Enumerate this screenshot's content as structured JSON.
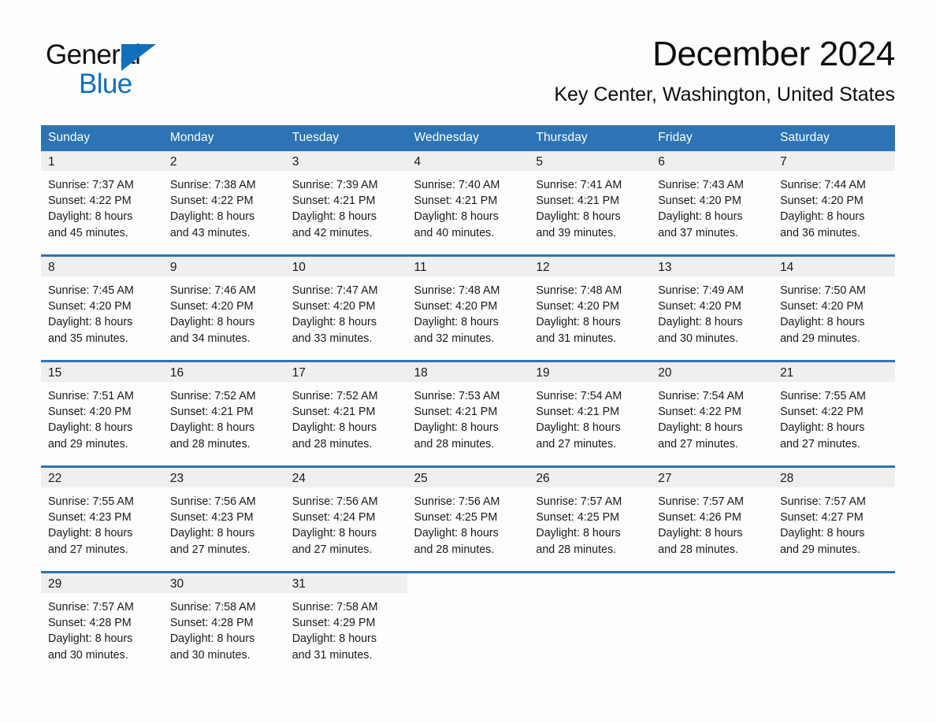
{
  "brand": {
    "line1": "General",
    "line2": "Blue",
    "mark": "triangle-logo",
    "accent_color": "#1270ba"
  },
  "header": {
    "month_title": "December 2024",
    "location": "Key Center, Washington, United States"
  },
  "theme": {
    "header_blue": "#2c74b3",
    "daybar_gray": "#efefef",
    "page_background": "#fdfdfd",
    "text_color": "#1a1a1a"
  },
  "calendar": {
    "weekday_headers": [
      "Sunday",
      "Monday",
      "Tuesday",
      "Wednesday",
      "Thursday",
      "Friday",
      "Saturday"
    ],
    "weeks": [
      [
        {
          "day": "1",
          "sunrise": "Sunrise: 7:37 AM",
          "sunset": "Sunset: 4:22 PM",
          "daylight_line1": "Daylight: 8 hours",
          "daylight_line2": "and 45 minutes."
        },
        {
          "day": "2",
          "sunrise": "Sunrise: 7:38 AM",
          "sunset": "Sunset: 4:22 PM",
          "daylight_line1": "Daylight: 8 hours",
          "daylight_line2": "and 43 minutes."
        },
        {
          "day": "3",
          "sunrise": "Sunrise: 7:39 AM",
          "sunset": "Sunset: 4:21 PM",
          "daylight_line1": "Daylight: 8 hours",
          "daylight_line2": "and 42 minutes."
        },
        {
          "day": "4",
          "sunrise": "Sunrise: 7:40 AM",
          "sunset": "Sunset: 4:21 PM",
          "daylight_line1": "Daylight: 8 hours",
          "daylight_line2": "and 40 minutes."
        },
        {
          "day": "5",
          "sunrise": "Sunrise: 7:41 AM",
          "sunset": "Sunset: 4:21 PM",
          "daylight_line1": "Daylight: 8 hours",
          "daylight_line2": "and 39 minutes."
        },
        {
          "day": "6",
          "sunrise": "Sunrise: 7:43 AM",
          "sunset": "Sunset: 4:20 PM",
          "daylight_line1": "Daylight: 8 hours",
          "daylight_line2": "and 37 minutes."
        },
        {
          "day": "7",
          "sunrise": "Sunrise: 7:44 AM",
          "sunset": "Sunset: 4:20 PM",
          "daylight_line1": "Daylight: 8 hours",
          "daylight_line2": "and 36 minutes."
        }
      ],
      [
        {
          "day": "8",
          "sunrise": "Sunrise: 7:45 AM",
          "sunset": "Sunset: 4:20 PM",
          "daylight_line1": "Daylight: 8 hours",
          "daylight_line2": "and 35 minutes."
        },
        {
          "day": "9",
          "sunrise": "Sunrise: 7:46 AM",
          "sunset": "Sunset: 4:20 PM",
          "daylight_line1": "Daylight: 8 hours",
          "daylight_line2": "and 34 minutes."
        },
        {
          "day": "10",
          "sunrise": "Sunrise: 7:47 AM",
          "sunset": "Sunset: 4:20 PM",
          "daylight_line1": "Daylight: 8 hours",
          "daylight_line2": "and 33 minutes."
        },
        {
          "day": "11",
          "sunrise": "Sunrise: 7:48 AM",
          "sunset": "Sunset: 4:20 PM",
          "daylight_line1": "Daylight: 8 hours",
          "daylight_line2": "and 32 minutes."
        },
        {
          "day": "12",
          "sunrise": "Sunrise: 7:48 AM",
          "sunset": "Sunset: 4:20 PM",
          "daylight_line1": "Daylight: 8 hours",
          "daylight_line2": "and 31 minutes."
        },
        {
          "day": "13",
          "sunrise": "Sunrise: 7:49 AM",
          "sunset": "Sunset: 4:20 PM",
          "daylight_line1": "Daylight: 8 hours",
          "daylight_line2": "and 30 minutes."
        },
        {
          "day": "14",
          "sunrise": "Sunrise: 7:50 AM",
          "sunset": "Sunset: 4:20 PM",
          "daylight_line1": "Daylight: 8 hours",
          "daylight_line2": "and 29 minutes."
        }
      ],
      [
        {
          "day": "15",
          "sunrise": "Sunrise: 7:51 AM",
          "sunset": "Sunset: 4:20 PM",
          "daylight_line1": "Daylight: 8 hours",
          "daylight_line2": "and 29 minutes."
        },
        {
          "day": "16",
          "sunrise": "Sunrise: 7:52 AM",
          "sunset": "Sunset: 4:21 PM",
          "daylight_line1": "Daylight: 8 hours",
          "daylight_line2": "and 28 minutes."
        },
        {
          "day": "17",
          "sunrise": "Sunrise: 7:52 AM",
          "sunset": "Sunset: 4:21 PM",
          "daylight_line1": "Daylight: 8 hours",
          "daylight_line2": "and 28 minutes."
        },
        {
          "day": "18",
          "sunrise": "Sunrise: 7:53 AM",
          "sunset": "Sunset: 4:21 PM",
          "daylight_line1": "Daylight: 8 hours",
          "daylight_line2": "and 28 minutes."
        },
        {
          "day": "19",
          "sunrise": "Sunrise: 7:54 AM",
          "sunset": "Sunset: 4:21 PM",
          "daylight_line1": "Daylight: 8 hours",
          "daylight_line2": "and 27 minutes."
        },
        {
          "day": "20",
          "sunrise": "Sunrise: 7:54 AM",
          "sunset": "Sunset: 4:22 PM",
          "daylight_line1": "Daylight: 8 hours",
          "daylight_line2": "and 27 minutes."
        },
        {
          "day": "21",
          "sunrise": "Sunrise: 7:55 AM",
          "sunset": "Sunset: 4:22 PM",
          "daylight_line1": "Daylight: 8 hours",
          "daylight_line2": "and 27 minutes."
        }
      ],
      [
        {
          "day": "22",
          "sunrise": "Sunrise: 7:55 AM",
          "sunset": "Sunset: 4:23 PM",
          "daylight_line1": "Daylight: 8 hours",
          "daylight_line2": "and 27 minutes."
        },
        {
          "day": "23",
          "sunrise": "Sunrise: 7:56 AM",
          "sunset": "Sunset: 4:23 PM",
          "daylight_line1": "Daylight: 8 hours",
          "daylight_line2": "and 27 minutes."
        },
        {
          "day": "24",
          "sunrise": "Sunrise: 7:56 AM",
          "sunset": "Sunset: 4:24 PM",
          "daylight_line1": "Daylight: 8 hours",
          "daylight_line2": "and 27 minutes."
        },
        {
          "day": "25",
          "sunrise": "Sunrise: 7:56 AM",
          "sunset": "Sunset: 4:25 PM",
          "daylight_line1": "Daylight: 8 hours",
          "daylight_line2": "and 28 minutes."
        },
        {
          "day": "26",
          "sunrise": "Sunrise: 7:57 AM",
          "sunset": "Sunset: 4:25 PM",
          "daylight_line1": "Daylight: 8 hours",
          "daylight_line2": "and 28 minutes."
        },
        {
          "day": "27",
          "sunrise": "Sunrise: 7:57 AM",
          "sunset": "Sunset: 4:26 PM",
          "daylight_line1": "Daylight: 8 hours",
          "daylight_line2": "and 28 minutes."
        },
        {
          "day": "28",
          "sunrise": "Sunrise: 7:57 AM",
          "sunset": "Sunset: 4:27 PM",
          "daylight_line1": "Daylight: 8 hours",
          "daylight_line2": "and 29 minutes."
        }
      ],
      [
        {
          "day": "29",
          "sunrise": "Sunrise: 7:57 AM",
          "sunset": "Sunset: 4:28 PM",
          "daylight_line1": "Daylight: 8 hours",
          "daylight_line2": "and 30 minutes."
        },
        {
          "day": "30",
          "sunrise": "Sunrise: 7:58 AM",
          "sunset": "Sunset: 4:28 PM",
          "daylight_line1": "Daylight: 8 hours",
          "daylight_line2": "and 30 minutes."
        },
        {
          "day": "31",
          "sunrise": "Sunrise: 7:58 AM",
          "sunset": "Sunset: 4:29 PM",
          "daylight_line1": "Daylight: 8 hours",
          "daylight_line2": "and 31 minutes."
        },
        {
          "day": "",
          "sunrise": "",
          "sunset": "",
          "daylight_line1": "",
          "daylight_line2": ""
        },
        {
          "day": "",
          "sunrise": "",
          "sunset": "",
          "daylight_line1": "",
          "daylight_line2": ""
        },
        {
          "day": "",
          "sunrise": "",
          "sunset": "",
          "daylight_line1": "",
          "daylight_line2": ""
        },
        {
          "day": "",
          "sunrise": "",
          "sunset": "",
          "daylight_line1": "",
          "daylight_line2": ""
        }
      ]
    ]
  }
}
